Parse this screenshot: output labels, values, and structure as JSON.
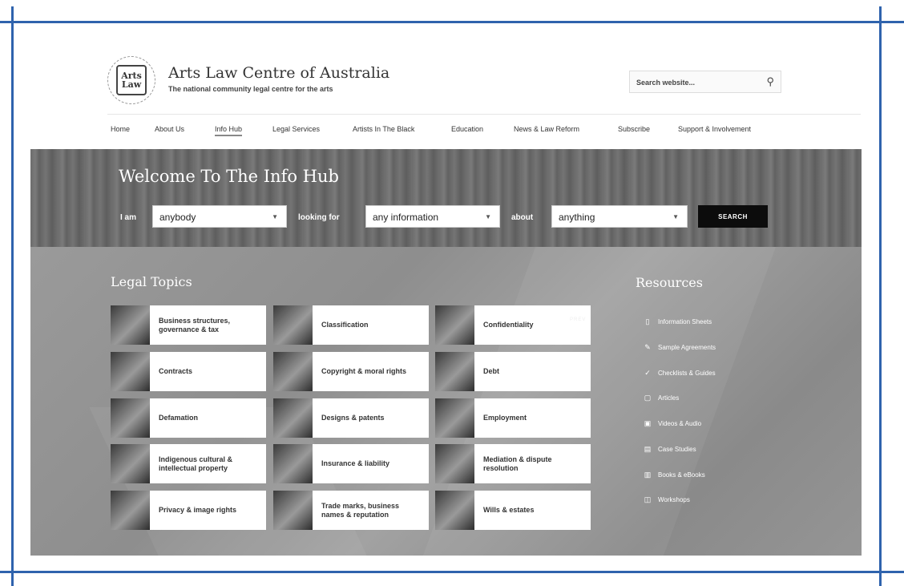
{
  "header": {
    "logo_text": "Arts Law",
    "title": "Arts Law Centre of Australia",
    "tagline": "The national community legal centre for the arts",
    "search_placeholder": "Search website...",
    "search_icon": "search-icon"
  },
  "nav": {
    "items": [
      {
        "label": "Home"
      },
      {
        "label": "About Us"
      },
      {
        "label": "Info Hub"
      },
      {
        "label": "Legal Services"
      },
      {
        "label": "Artists In The Black"
      },
      {
        "label": "Education"
      },
      {
        "label": "News & Law Reform"
      },
      {
        "label": "Subscribe"
      },
      {
        "label": "Support & Involvement"
      }
    ],
    "active": "Info Hub"
  },
  "hero": {
    "title": "Welcome To The Info Hub",
    "i_am_label": "I am",
    "i_am_value": "anybody",
    "looking_for_label": "looking for",
    "looking_for_value": "any information",
    "about_label": "about",
    "about_value": "anything",
    "search_button": "SEARCH"
  },
  "legal_topics": {
    "title": "Legal Topics",
    "items": [
      {
        "label": "Business structures, governance & tax"
      },
      {
        "label": "Classification"
      },
      {
        "label": "Confidentiality"
      },
      {
        "label": "Contracts"
      },
      {
        "label": "Copyright & moral rights"
      },
      {
        "label": "Debt"
      },
      {
        "label": "Defamation"
      },
      {
        "label": "Designs & patents"
      },
      {
        "label": "Employment"
      },
      {
        "label": "Indigenous cultural & intellectual property"
      },
      {
        "label": "Insurance & liability"
      },
      {
        "label": "Mediation & dispute resolution"
      },
      {
        "label": "Privacy & image rights"
      },
      {
        "label": "Trade marks, business names & reputation"
      },
      {
        "label": "Wills & estates"
      }
    ],
    "prev_text": "PREV"
  },
  "resources": {
    "title": "Resources",
    "items": [
      {
        "label": "Information Sheets",
        "icon": "document-icon",
        "glyph": "▯"
      },
      {
        "label": "Sample Agreements",
        "icon": "pen-icon",
        "glyph": "✎"
      },
      {
        "label": "Checklists & Guides",
        "icon": "check-icon",
        "glyph": "✓"
      },
      {
        "label": "Articles",
        "icon": "article-icon",
        "glyph": "▢"
      },
      {
        "label": "Videos & Audio",
        "icon": "video-icon",
        "glyph": "▣"
      },
      {
        "label": "Case Studies",
        "icon": "folder-icon",
        "glyph": "▤"
      },
      {
        "label": "Books & eBooks",
        "icon": "book-icon",
        "glyph": "▥"
      },
      {
        "label": "Workshops",
        "icon": "workshop-icon",
        "glyph": "◫"
      }
    ]
  },
  "colors": {
    "frame": "#2f63ad",
    "hero_bg": "#6d6d6d",
    "content_bg": "#959595",
    "button_bg": "#0c0c0c"
  }
}
